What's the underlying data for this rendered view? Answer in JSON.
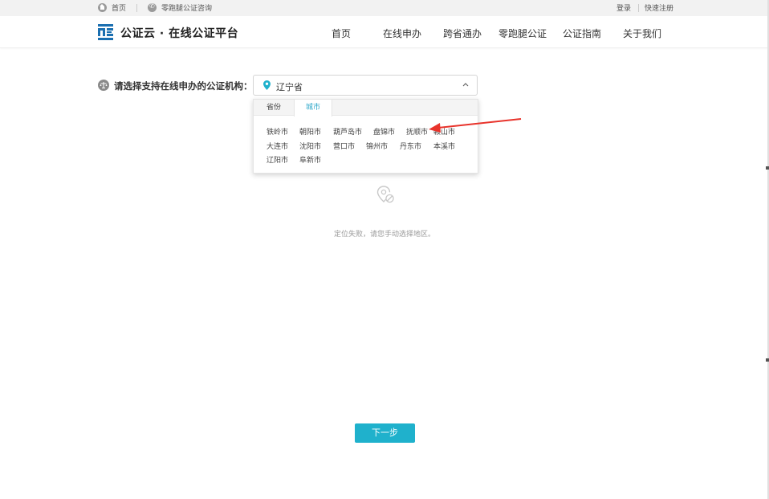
{
  "topbar": {
    "home_link": "首页",
    "consult_link": "零跑腿公证咨询",
    "login": "登录",
    "register": "快速注册"
  },
  "header": {
    "brand": "公证云 · 在线公证平台",
    "nav": [
      "首页",
      "在线申办",
      "跨省通办",
      "零跑腿公证",
      "公证指南",
      "关于我们"
    ]
  },
  "form": {
    "label": "请选择支持在线申办的公证机构：",
    "selected_value": "辽宁省"
  },
  "dropdown": {
    "tabs": [
      "省份",
      "城市"
    ],
    "active_tab": "城市",
    "cities": [
      [
        "铁岭市",
        "朝阳市",
        "葫芦岛市",
        "盘锦市",
        "抚顺市",
        "鞍山市"
      ],
      [
        "大连市",
        "沈阳市",
        "营口市",
        "锦州市",
        "丹东市",
        "本溪市"
      ],
      [
        "辽阳市",
        "阜新市"
      ]
    ]
  },
  "empty_state": {
    "message": "定位失败，请您手动选择地区。"
  },
  "actions": {
    "next": "下一步"
  },
  "colors": {
    "accent": "#1fb1cc",
    "tab_active": "#2aa6c9",
    "logo_blue": "#1b6fb0",
    "arrow": "#e8332b"
  }
}
